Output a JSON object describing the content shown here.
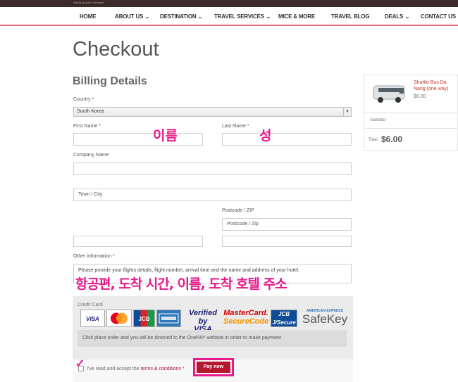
{
  "brand": {
    "tagline": "Santa Accom Vietnam"
  },
  "nav": {
    "items": [
      {
        "label": "HOME",
        "dropdown": false
      },
      {
        "label": "ABOUT US",
        "dropdown": true
      },
      {
        "label": "DESTINATION",
        "dropdown": true
      },
      {
        "label": "TRAVEL SERVICES",
        "dropdown": true
      },
      {
        "label": "MICE & MORE",
        "dropdown": false
      },
      {
        "label": "TRAVEL BLOG",
        "dropdown": false
      },
      {
        "label": "DEALS",
        "dropdown": true
      },
      {
        "label": "CONTACT US",
        "dropdown": false
      }
    ],
    "accent_color": "#d6667e"
  },
  "page": {
    "title": "Checkout"
  },
  "billing": {
    "title": "Billing Details",
    "country": {
      "label": "Country",
      "value": "South Korea"
    },
    "first_name": {
      "label": "First Name",
      "value": ""
    },
    "last_name": {
      "label": "Last Name",
      "value": ""
    },
    "company": {
      "label": "Company Name",
      "value": ""
    },
    "address": {
      "value": ""
    },
    "city": {
      "placeholder": "Town / City"
    },
    "postcode": {
      "label": "Postcode / ZIP",
      "placeholder": "Postcode / Zip"
    },
    "other_info": {
      "label": "Other information",
      "placeholder": "Please provide your flights details, flight number, arrival time and the name and address of your hotel."
    }
  },
  "annotations": {
    "first_name": "이름",
    "last_name": "성",
    "other_info": "항공편, 도착 시간, 이름, 도착 호텔 주소",
    "color": "#e8198b"
  },
  "payment": {
    "label": "Credit Card",
    "cards": [
      "VISA",
      "MasterCard",
      "JCB",
      "American Express",
      "Verified by VISA",
      "MasterCard SecureCode",
      "JCB J/Secure",
      "American Express SafeKey"
    ],
    "card_texts": {
      "visa": "VISA",
      "jcb": "JCB",
      "verified_top": "Verified by",
      "verified_bottom": "VISA",
      "mc_top": "MasterCard.",
      "mc_bottom": "SecureCode",
      "safekey_top": "AMERICAN EXPRESS",
      "safekey_bottom": "SafeKey"
    },
    "notice": "Click place order and you will be directed to the OnePAY website in order to make payment",
    "terms_prefix": "I've read and accept the",
    "terms_link": "terms & conditions",
    "pay_button": "Pay now",
    "button_color": "#b5182e"
  },
  "order": {
    "product_name": "Shuttle Bus Da Nang (one way)",
    "product_price": "$6.00",
    "subtotal_label": "Subtotal",
    "total_label": "Total",
    "total_value": "$6.00"
  }
}
